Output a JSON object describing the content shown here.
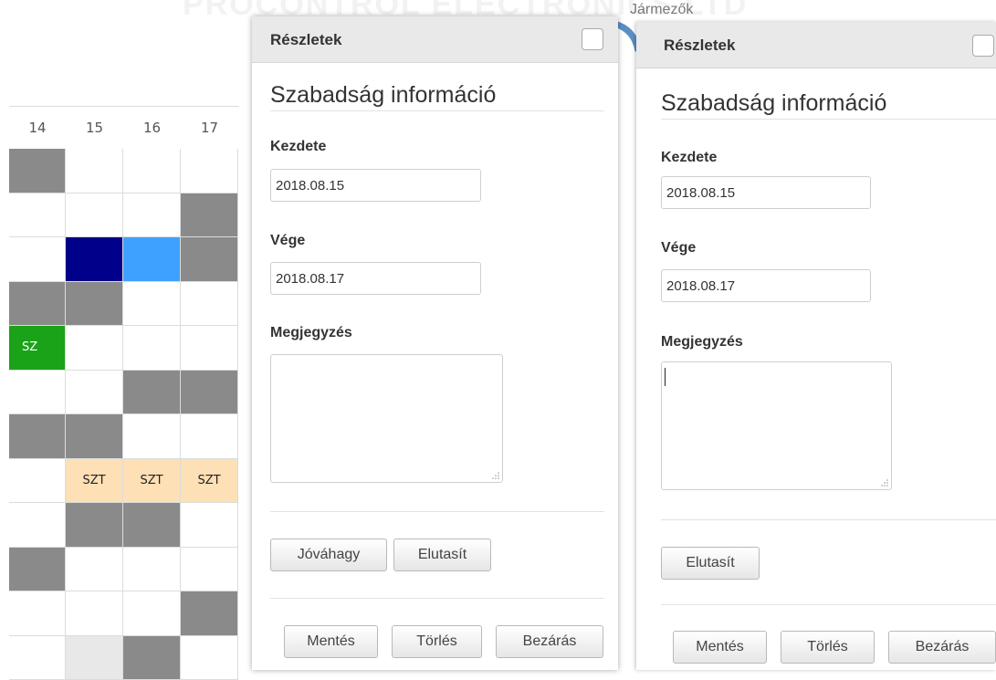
{
  "background": {
    "watermark_text": "PROCONTROL ELECTRONICS LTD",
    "partial_text": "Jármezők"
  },
  "calendar": {
    "days": [
      "14",
      "15",
      "16",
      "17"
    ],
    "rows": [
      [
        "gray",
        "",
        "",
        ""
      ],
      [
        "",
        "",
        "",
        "gray"
      ],
      [
        "",
        "navy",
        "sky",
        "gray"
      ],
      [
        "gray",
        "gray",
        "",
        ""
      ],
      [
        {
          "c": "green",
          "t": "SZ"
        },
        "",
        "",
        ""
      ],
      [
        "",
        "",
        "gray",
        "gray"
      ],
      [
        "gray",
        "gray",
        "",
        ""
      ],
      [
        "",
        {
          "c": "peach",
          "t": "SZT"
        },
        {
          "c": "peach",
          "t": "SZT"
        },
        {
          "c": "peach",
          "t": "SZT"
        }
      ],
      [
        "",
        "gray",
        "gray",
        ""
      ],
      [
        "gray",
        "",
        "",
        ""
      ],
      [
        "",
        "",
        "",
        "gray"
      ],
      [
        "",
        "light",
        "gray",
        ""
      ]
    ]
  },
  "panel1": {
    "header_title": "Részletek",
    "heading": "Szabadság információ",
    "start_label": "Kezdete",
    "start_value": "2018.08.15",
    "end_label": "Vége",
    "end_value": "2018.08.17",
    "note_label": "Megjegyzés",
    "approve_button": "Jóváhagy",
    "reject_button": "Elutasít",
    "save_button": "Mentés",
    "delete_button": "Törlés",
    "close_button": "Bezárás"
  },
  "panel2": {
    "header_title": "Részletek",
    "heading": "Szabadság információ",
    "start_label": "Kezdete",
    "start_value": "2018.08.15",
    "end_label": "Vége",
    "end_value": "2018.08.17",
    "note_label": "Megjegyzés",
    "reject_button": "Elutasít",
    "save_button": "Mentés",
    "delete_button": "Törlés",
    "close_button": "Bezárás"
  },
  "colors": {
    "gray": "#8a8a8a",
    "navy": "#00008b",
    "sky": "#3ea1ff",
    "green": "#1aa318",
    "peach": "#fde0b5",
    "light": "#e8e8e8"
  }
}
